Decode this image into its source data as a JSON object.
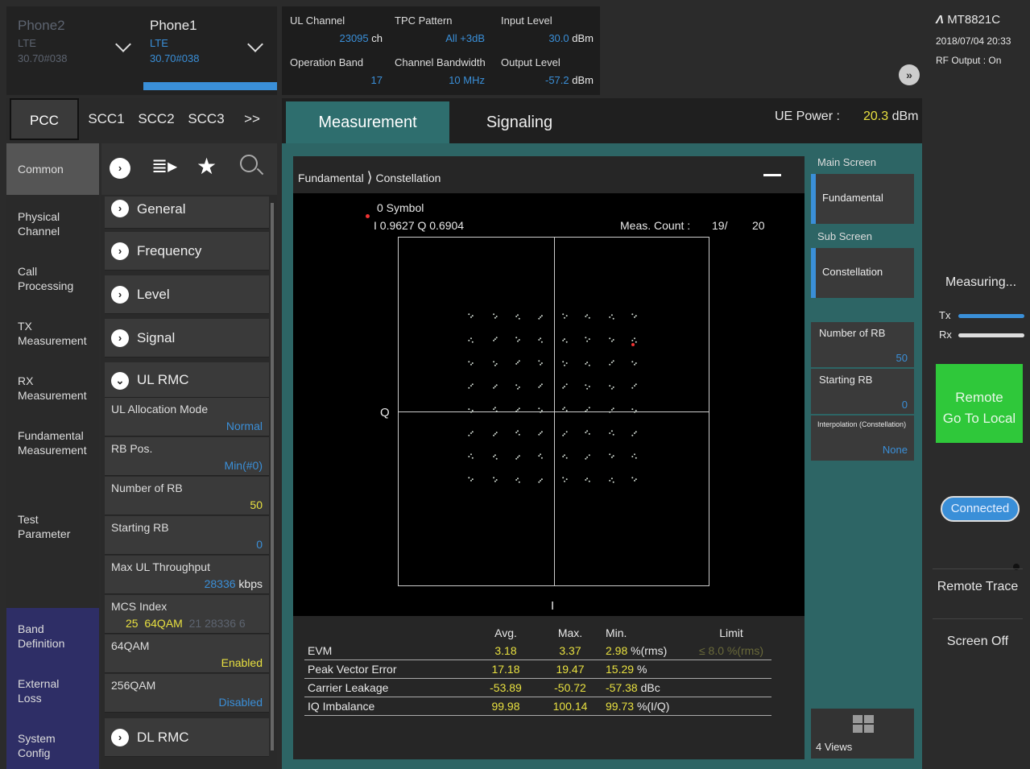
{
  "phones": {
    "phone2": {
      "name": "Phone2",
      "tech": "LTE",
      "id": "30.70#038"
    },
    "phone1": {
      "name": "Phone1",
      "tech": "LTE",
      "id": "30.70#038"
    }
  },
  "status": {
    "ul_channel_label": "UL Channel",
    "ul_channel_value": "23095",
    "ul_channel_unit": "ch",
    "tpc_label": "TPC Pattern",
    "tpc_value": "All +3dB",
    "input_level_label": "Input Level",
    "input_level_value": "30.0",
    "input_level_unit": "dBm",
    "op_band_label": "Operation Band",
    "op_band_value": "17",
    "ch_bw_label": "Channel Bandwidth",
    "ch_bw_value": "10 MHz",
    "output_level_label": "Output Level",
    "output_level_value": "-57.2",
    "output_level_unit": "dBm"
  },
  "device": {
    "model": "MT8821C",
    "datetime": "2018/07/04 20:33",
    "rf_output": "RF Output : On"
  },
  "carrier_tabs": [
    "PCC",
    "SCC1",
    "SCC2",
    "SCC3",
    ">>"
  ],
  "nav": {
    "common": "Common",
    "items": [
      {
        "l1": "Physical",
        "l2": "Channel"
      },
      {
        "l1": "Call",
        "l2": "Processing"
      },
      {
        "l1": "TX",
        "l2": "Measurement"
      },
      {
        "l1": "RX",
        "l2": "Measurement"
      },
      {
        "l1": "Fundamental",
        "l2": "Measurement"
      },
      {
        "l1": "Test",
        "l2": "Parameter"
      },
      {
        "l1": "Band",
        "l2": "Definition"
      },
      {
        "l1": "External",
        "l2": "Loss"
      },
      {
        "l1": "System",
        "l2": "Config"
      }
    ]
  },
  "params": {
    "general": "General",
    "frequency": "Frequency",
    "level": "Level",
    "signal": "Signal",
    "ul_rmc": "UL RMC",
    "ul_alloc_label": "UL Allocation Mode",
    "ul_alloc_value": "Normal",
    "rb_pos_label": "RB Pos.",
    "rb_pos_value": "Min(#0)",
    "num_rb_label": "Number of RB",
    "num_rb_value": "50",
    "start_rb_label": "Starting RB",
    "start_rb_value": "0",
    "max_tp_label": "Max UL Throughput",
    "max_tp_value": "28336",
    "max_tp_unit": "kbps",
    "mcs_label": "MCS Index",
    "mcs_value": "25",
    "mcs_mod": "64QAM",
    "mcs_extra": "21  28336  6",
    "qam64_label": "64QAM",
    "qam64_value": "Enabled",
    "qam256_label": "256QAM",
    "qam256_value": "Disabled",
    "dl_rmc": "DL RMC"
  },
  "main_tabs": {
    "measurement": "Measurement",
    "signaling": "Signaling"
  },
  "ue_power": {
    "label": "UE Power :",
    "value": "20.3",
    "unit": "dBm"
  },
  "graph": {
    "breadcrumb1": "Fundamental",
    "breadcrumb2": "Constellation",
    "symbol_line": "0 Symbol",
    "iq_line": "I 0.9627  Q 0.6904",
    "meas_count_label": "Meas. Count :",
    "meas_count_value": "19/",
    "meas_count_total": "20",
    "q_label": "Q",
    "i_label": "I"
  },
  "results": {
    "headers": [
      "",
      "Avg.",
      "Max.",
      "Min.",
      "Limit"
    ],
    "rows": [
      {
        "name": "EVM",
        "avg": "3.18",
        "max": "3.37",
        "min": "2.98",
        "unit": "%(rms)",
        "limit": "≤ 8.0 %(rms)"
      },
      {
        "name": "Peak Vector Error",
        "avg": "17.18",
        "max": "19.47",
        "min": "15.29",
        "unit": "%",
        "limit": ""
      },
      {
        "name": "Carrier Leakage",
        "avg": "-53.89",
        "max": "-50.72",
        "min": "-57.38",
        "unit": "dBc",
        "limit": ""
      },
      {
        "name": "IQ Imbalance",
        "avg": "99.98",
        "max": "100.14",
        "min": "99.73",
        "unit": "%(I/Q)",
        "limit": ""
      }
    ]
  },
  "right_col": {
    "main_screen": "Main Screen",
    "fundamental": "Fundamental",
    "sub_screen": "Sub Screen",
    "constellation": "Constellation",
    "num_rb_label": "Number of RB",
    "num_rb_value": "50",
    "start_rb_label": "Starting RB",
    "start_rb_value": "0",
    "interp_label": "Interpolation (Constellation)",
    "interp_value": "None",
    "views": "4 Views"
  },
  "far_right": {
    "measuring": "Measuring...",
    "tx": "Tx",
    "rx": "Rx",
    "remote": "Remote",
    "go_local": "Go To Local",
    "connected": "Connected",
    "remote_trace": "Remote Trace",
    "screen_off": "Screen Off"
  },
  "colors": {
    "accent": "#3a8fd8",
    "value_yellow": "#e8e040",
    "teal": "#2d6565",
    "green": "#2fc83a"
  }
}
